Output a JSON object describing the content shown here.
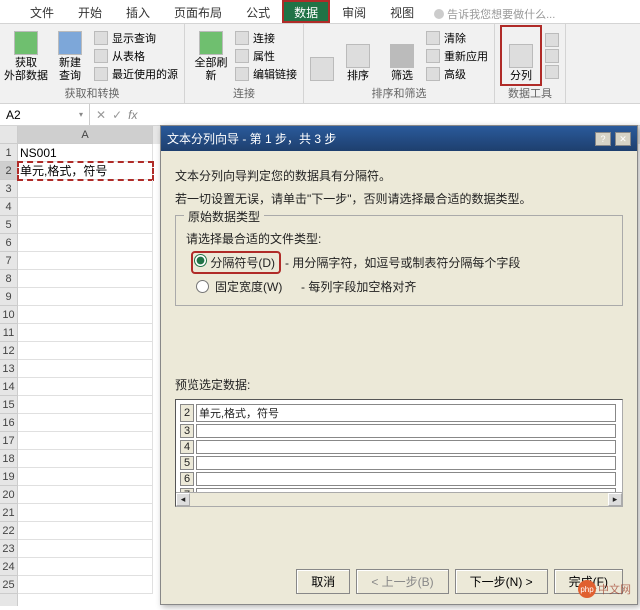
{
  "tabs": {
    "file": "文件",
    "home": "开始",
    "insert": "插入",
    "layout": "页面布局",
    "formulas": "公式",
    "data": "数据",
    "review": "审阅",
    "view": "视图"
  },
  "tellme": "告诉我您想要做什么...",
  "ribbon": {
    "group1": {
      "get_data": "获取\n外部数据",
      "new_query": "新建\n查询",
      "show_queries": "显示查询",
      "from_table": "从表格",
      "recent": "最近使用的源",
      "label": "获取和转换"
    },
    "group2": {
      "refresh": "全部刷新",
      "connections": "连接",
      "properties": "属性",
      "edit_links": "编辑链接",
      "label": "连接"
    },
    "group3": {
      "sort": "排序",
      "filter": "筛选",
      "clear": "清除",
      "reapply": "重新应用",
      "advanced": "高级",
      "label": "排序和筛选"
    },
    "group4": {
      "text_to_cols": "分列",
      "label": "数据工具"
    }
  },
  "namebox": "A2",
  "grid": {
    "colA": "A",
    "cellA1": "NS001",
    "cellA2": "单元,格式，符号"
  },
  "dialog": {
    "title": "文本分列向导 - 第 1 步，共 3 步",
    "line1": "文本分列向导判定您的数据具有分隔符。",
    "line2": "若一切设置无误，请单击\"下一步\"，否则请选择最合适的数据类型。",
    "section_title": "原始数据类型",
    "prompt": "请选择最合适的文件类型:",
    "opt1_label": "分隔符号(D)",
    "opt1_desc": "- 用分隔字符，如逗号或制表符分隔每个字段",
    "opt2_label": "固定宽度(W)",
    "opt2_desc": "- 每列字段加空格对齐",
    "preview_label": "预览选定数据:",
    "preview_cell": "单元,格式，符号",
    "btn_cancel": "取消",
    "btn_back": "< 上一步(B)",
    "btn_next": "下一步(N) >",
    "btn_finish": "完成(F)"
  },
  "watermark": {
    "php": "php",
    "text": "中文网"
  }
}
